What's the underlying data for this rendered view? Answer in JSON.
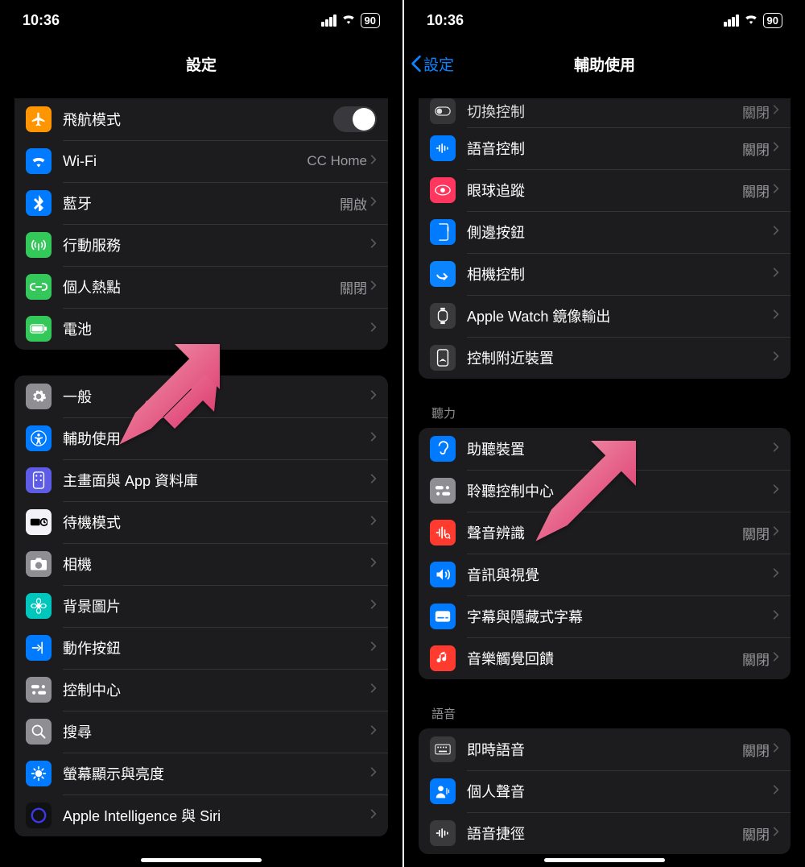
{
  "status": {
    "time": "10:36",
    "battery": "90"
  },
  "left": {
    "title": "設定",
    "rows1": [
      {
        "name": "airplane-mode",
        "icon": "airplane",
        "iconbg": "bg-orange",
        "label": "飛航模式",
        "control": "toggle"
      },
      {
        "name": "wifi",
        "icon": "wifi",
        "iconbg": "bg-blue",
        "label": "Wi-Fi",
        "value": "CC Home",
        "chev": true
      },
      {
        "name": "bluetooth",
        "icon": "bluetooth",
        "iconbg": "bg-blue",
        "label": "藍牙",
        "value": "開啟",
        "chev": true
      },
      {
        "name": "cellular",
        "icon": "antenna",
        "iconbg": "bg-green",
        "label": "行動服務",
        "chev": true
      },
      {
        "name": "hotspot",
        "icon": "link",
        "iconbg": "bg-green",
        "label": "個人熱點",
        "value": "關閉",
        "chev": true
      },
      {
        "name": "battery",
        "icon": "battery",
        "iconbg": "bg-green",
        "label": "電池",
        "chev": true
      }
    ],
    "rows2": [
      {
        "name": "general",
        "icon": "gear",
        "iconbg": "bg-gray",
        "label": "一般",
        "chev": true
      },
      {
        "name": "accessibility",
        "icon": "accessibility",
        "iconbg": "bg-blue",
        "label": "輔助使用",
        "chev": true
      },
      {
        "name": "homescreen-applib",
        "icon": "homescreen",
        "iconbg": "bg-indigo",
        "label": "主畫面與 App 資料庫",
        "chev": true
      },
      {
        "name": "standby",
        "icon": "standby",
        "iconbg": "bg-white",
        "label": "待機模式",
        "chev": true
      },
      {
        "name": "camera",
        "icon": "camera",
        "iconbg": "bg-gray",
        "label": "相機",
        "chev": true
      },
      {
        "name": "wallpaper",
        "icon": "flower",
        "iconbg": "bg-mint",
        "label": "背景圖片",
        "chev": true
      },
      {
        "name": "action-button",
        "icon": "action",
        "iconbg": "bg-blue",
        "label": "動作按鈕",
        "chev": true
      },
      {
        "name": "control-center",
        "icon": "switches",
        "iconbg": "bg-gray",
        "label": "控制中心",
        "chev": true
      },
      {
        "name": "search",
        "icon": "search",
        "iconbg": "bg-gray",
        "label": "搜尋",
        "chev": true
      },
      {
        "name": "display-brightness",
        "icon": "brightness",
        "iconbg": "bg-blue",
        "label": "螢幕顯示與亮度",
        "chev": true
      },
      {
        "name": "apple-intelligence-siri",
        "icon": "ai",
        "iconbg": "bg-black",
        "label": "Apple Intelligence 與 Siri",
        "chev": true
      }
    ],
    "arrow_target": "accessibility"
  },
  "right": {
    "title": "輔助使用",
    "back_label": "設定",
    "rows1": [
      {
        "name": "switch-control",
        "icon": "switchctrl",
        "iconbg": "bg-darkgray",
        "label": "切換控制",
        "value": "關閉",
        "chev": true,
        "peek": true
      },
      {
        "name": "voice-control",
        "icon": "voice",
        "iconbg": "bg-blue",
        "label": "語音控制",
        "value": "關閉",
        "chev": true
      },
      {
        "name": "eye-tracking",
        "icon": "eye",
        "iconbg": "bg-pink",
        "label": "眼球追蹤",
        "value": "關閉",
        "chev": true
      },
      {
        "name": "side-button",
        "icon": "sidebtn",
        "iconbg": "bg-blue",
        "label": "側邊按鈕",
        "chev": true
      },
      {
        "name": "camera-control",
        "icon": "camctrl",
        "iconbg": "bg-blue2",
        "label": "相機控制",
        "chev": true
      },
      {
        "name": "apple-watch-mirror",
        "icon": "awatch",
        "iconbg": "bg-darkgray",
        "label": "Apple Watch 鏡像輸出",
        "chev": true
      },
      {
        "name": "nearby-control",
        "icon": "nearby",
        "iconbg": "bg-darkgray",
        "label": "控制附近裝置",
        "chev": true
      }
    ],
    "section2_header": "聽力",
    "rows2": [
      {
        "name": "hearing-devices",
        "icon": "ear",
        "iconbg": "bg-blue",
        "label": "助聽裝置",
        "chev": true
      },
      {
        "name": "hearing-control-center",
        "icon": "switches",
        "iconbg": "bg-gray",
        "label": "聆聽控制中心",
        "chev": true
      },
      {
        "name": "sound-recognition",
        "icon": "soundrec",
        "iconbg": "bg-red",
        "label": "聲音辨識",
        "value": "關閉",
        "chev": true
      },
      {
        "name": "audio-visual",
        "icon": "speaker",
        "iconbg": "bg-blue",
        "label": "音訊與視覺",
        "chev": true
      },
      {
        "name": "subtitles",
        "icon": "subtitle",
        "iconbg": "bg-blue",
        "label": "字幕與隱藏式字幕",
        "chev": true
      },
      {
        "name": "music-haptics",
        "icon": "musichap",
        "iconbg": "bg-red",
        "label": "音樂觸覺回饋",
        "value": "關閉",
        "chev": true
      }
    ],
    "section3_header": "語音",
    "rows3": [
      {
        "name": "live-speech",
        "icon": "keyboard",
        "iconbg": "bg-darkgray",
        "label": "即時語音",
        "value": "關閉",
        "chev": true
      },
      {
        "name": "personal-voice",
        "icon": "personvoice",
        "iconbg": "bg-blue",
        "label": "個人聲音",
        "chev": true
      },
      {
        "name": "voice-shortcut",
        "icon": "voiceshort",
        "iconbg": "bg-darkgray",
        "label": "語音捷徑",
        "value": "關閉",
        "chev": true
      }
    ],
    "arrow_target": "sound-recognition"
  }
}
